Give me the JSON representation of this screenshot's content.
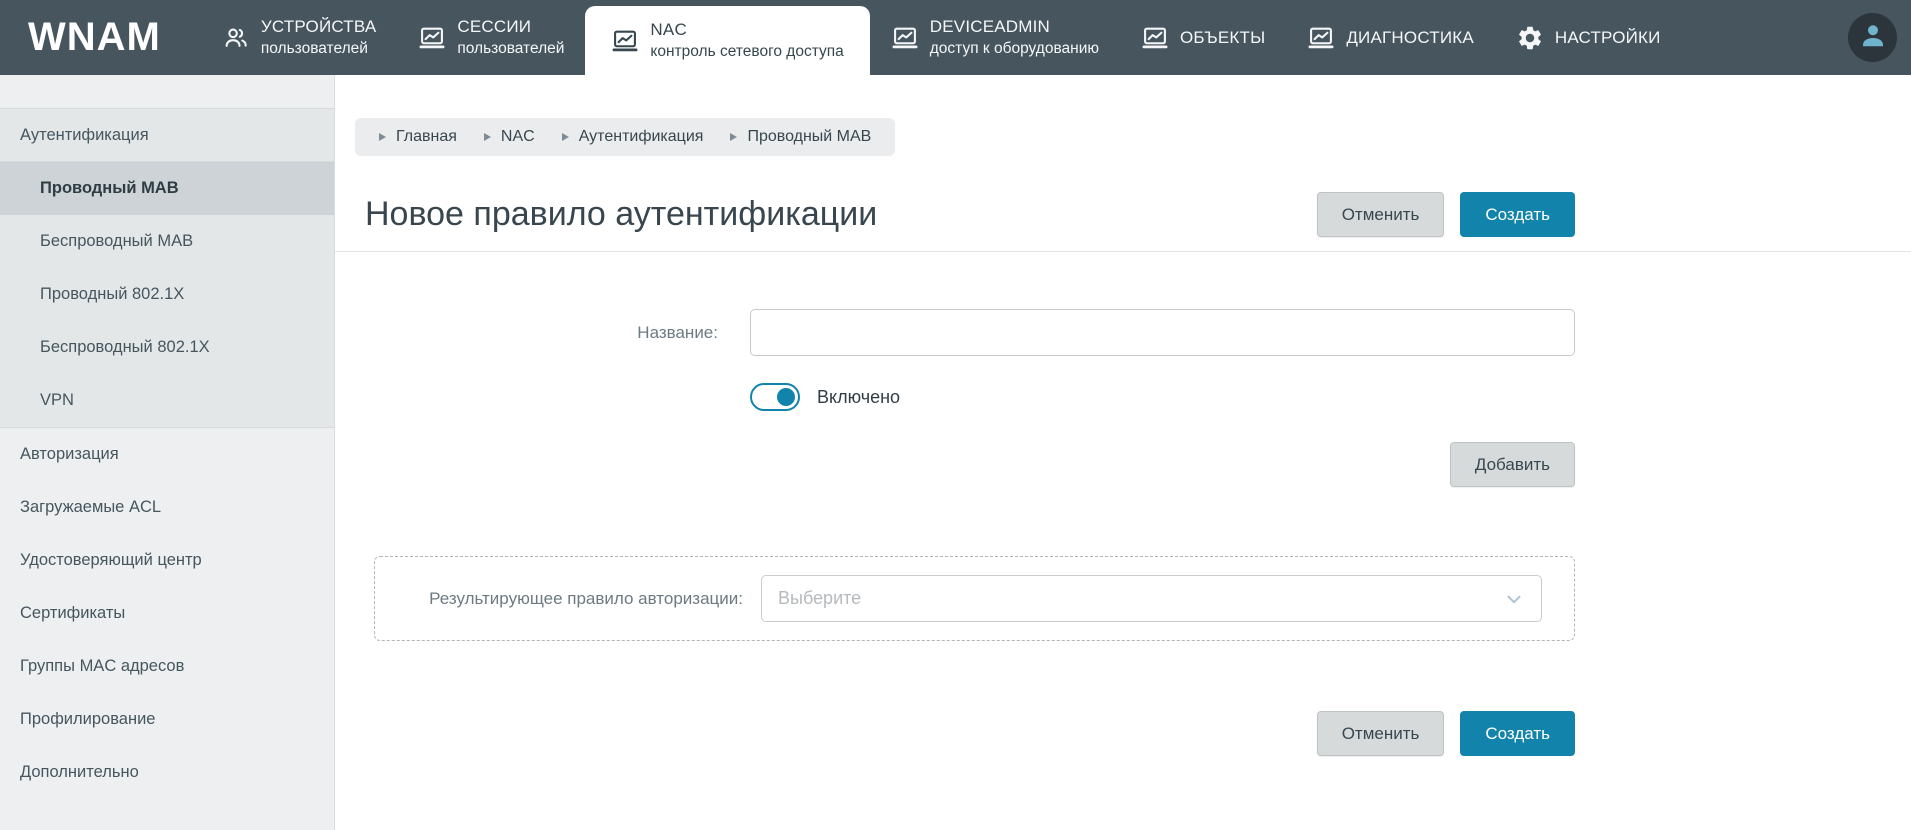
{
  "app": {
    "logo": "WNAM"
  },
  "colors": {
    "topbar_bg": "#46555e",
    "accent_blue": "#1283ab",
    "sidebar_bg": "#edeff0",
    "sidebar_active_bg": "#cdd3d6",
    "avatar_icon": "#6fb3cd"
  },
  "topnav": {
    "items": [
      {
        "label": "УСТРОЙСТВА",
        "sublabel": "пользователей",
        "icon": "people-icon",
        "active": false
      },
      {
        "label": "СЕССИИ",
        "sublabel": "пользователей",
        "icon": "monitor-chart-icon",
        "active": false
      },
      {
        "label": "NAC",
        "sublabel": "контроль сетевого доступа",
        "icon": "monitor-chart-icon",
        "active": true
      },
      {
        "label": "DEVICEADMIN",
        "sublabel": "доступ к оборудованию",
        "icon": "monitor-chart-icon",
        "active": false
      },
      {
        "label": "ОБЪЕКТЫ",
        "sublabel": "",
        "icon": "monitor-chart-icon",
        "active": false
      },
      {
        "label": "ДИАГНОСТИКА",
        "sublabel": "",
        "icon": "monitor-chart-icon",
        "active": false
      },
      {
        "label": "НАСТРОЙКИ",
        "sublabel": "",
        "icon": "gear-icon",
        "active": false
      }
    ]
  },
  "sidebar": {
    "items": [
      {
        "label": "Аутентификация"
      },
      {
        "label": "Проводный MAB",
        "active": true
      },
      {
        "label": "Беспроводный MAB"
      },
      {
        "label": "Проводный 802.1X"
      },
      {
        "label": "Беспроводный 802.1X"
      },
      {
        "label": "VPN"
      },
      {
        "label": "Авторизация"
      },
      {
        "label": "Загружаемые ACL"
      },
      {
        "label": "Удостоверяющий центр"
      },
      {
        "label": "Сертификаты"
      },
      {
        "label": "Группы MAC адресов"
      },
      {
        "label": "Профилирование"
      },
      {
        "label": "Дополнительно"
      }
    ]
  },
  "breadcrumb": {
    "items": [
      "Главная",
      "NAC",
      "Аутентификация",
      "Проводный MAB"
    ]
  },
  "page": {
    "title": "Новое правило аутентификации",
    "cancel_label": "Отменить",
    "create_label": "Создать"
  },
  "form": {
    "name_label": "Название:",
    "name_value": "",
    "toggle_label": "Включено",
    "toggle_on": true,
    "add_label": "Добавить",
    "result_rule_label": "Результирующее правило авторизации:",
    "result_rule_placeholder": "Выберите"
  }
}
